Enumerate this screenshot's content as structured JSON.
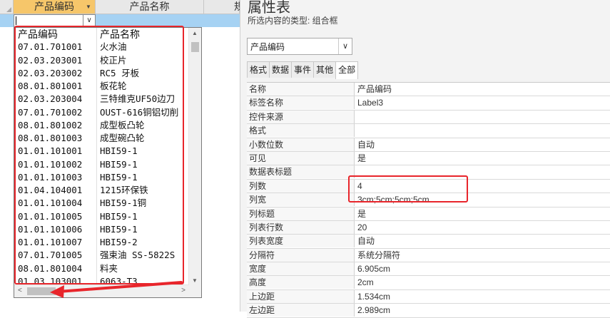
{
  "datasheet": {
    "headers": {
      "code": "产品编码",
      "name": "产品名称",
      "extra": "规"
    }
  },
  "dropdown": {
    "columns": [
      "产品编码",
      "产品名称"
    ],
    "rows": [
      [
        "07.01.701001",
        "火水油"
      ],
      [
        "02.03.203001",
        "校正片"
      ],
      [
        "02.03.203002",
        "RC5 牙板"
      ],
      [
        "08.01.801001",
        "板花轮"
      ],
      [
        "02.03.203004",
        "三特维克UF50边刀"
      ],
      [
        "07.01.701002",
        "OUST-616铜铝切削"
      ],
      [
        "08.01.801002",
        "成型板凸轮"
      ],
      [
        "08.01.801003",
        "成型碗凸轮"
      ],
      [
        "01.01.101001",
        "HBI59-1"
      ],
      [
        "01.01.101002",
        "HBI59-1"
      ],
      [
        "01.01.101003",
        "HBI59-1"
      ],
      [
        "01.04.104001",
        "1215环保铁"
      ],
      [
        "01.01.101004",
        "HBI59-1铜"
      ],
      [
        "01.01.101005",
        "HBI59-1"
      ],
      [
        "01.01.101006",
        "HBI59-1"
      ],
      [
        "01.01.101007",
        "HBI59-2"
      ],
      [
        "07.01.701005",
        "强束油 SS-5822S"
      ],
      [
        "08.01.801004",
        "料夹"
      ],
      [
        "01.03.103001",
        "6063-T3"
      ]
    ]
  },
  "property_sheet": {
    "title": "属性表",
    "subtitle": "所选内容的类型: 组合框",
    "selector_value": "产品编码",
    "tabs": [
      "格式",
      "数据",
      "事件",
      "其他",
      "全部"
    ],
    "active_tab": "全部",
    "rows": [
      [
        "名称",
        "产品编码"
      ],
      [
        "标签名称",
        "Label3"
      ],
      [
        "控件来源",
        ""
      ],
      [
        "格式",
        ""
      ],
      [
        "小数位数",
        "自动"
      ],
      [
        "可见",
        "是"
      ],
      [
        "数据表标题",
        ""
      ],
      [
        "列数",
        "4"
      ],
      [
        "列宽",
        "3cm;5cm;5cm;5cm"
      ],
      [
        "列标题",
        "是"
      ],
      [
        "列表行数",
        "20"
      ],
      [
        "列表宽度",
        "自动"
      ],
      [
        "分隔符",
        "系统分隔符"
      ],
      [
        "宽度",
        "6.905cm"
      ],
      [
        "高度",
        "2cm"
      ],
      [
        "上边距",
        "1.534cm"
      ],
      [
        "左边距",
        "2.989cm"
      ]
    ]
  },
  "colors": {
    "highlight_header": "#f6c66a",
    "selected_row": "#a6d2f3",
    "annotation_red": "#e8252b"
  }
}
